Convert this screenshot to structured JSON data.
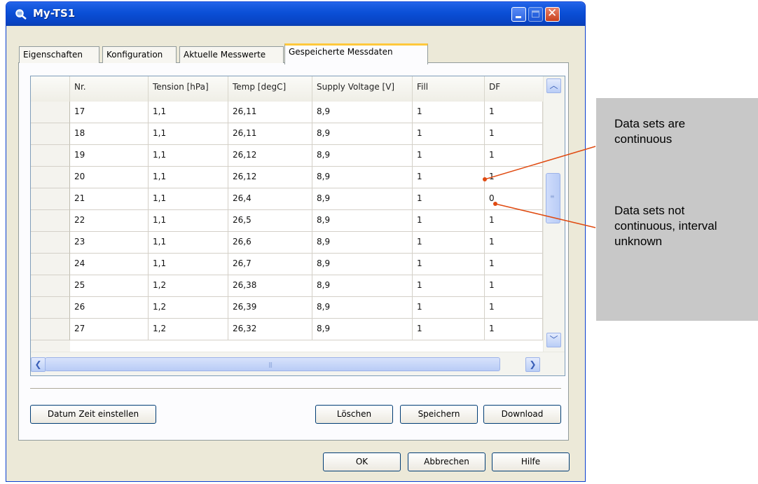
{
  "window": {
    "title": "My-TS1"
  },
  "tabs": [
    {
      "label": "Eigenschaften"
    },
    {
      "label": "Konfiguration"
    },
    {
      "label": "Aktuelle Messwerte"
    },
    {
      "label": "Gespeicherte Messdaten",
      "active": true
    }
  ],
  "grid": {
    "columns": [
      "Nr.",
      "Tension [hPa]",
      "Temp [degC]",
      "Supply Voltage [V]",
      "Fill",
      "DF"
    ],
    "rows": [
      [
        "17",
        "1,1",
        "26,11",
        "8,9",
        "1",
        "1"
      ],
      [
        "18",
        "1,1",
        "26,11",
        "8,9",
        "1",
        "1"
      ],
      [
        "19",
        "1,1",
        "26,12",
        "8,9",
        "1",
        "1"
      ],
      [
        "20",
        "1,1",
        "26,12",
        "8,9",
        "1",
        "1"
      ],
      [
        "21",
        "1,1",
        "26,4",
        "8,9",
        "1",
        "0"
      ],
      [
        "22",
        "1,1",
        "26,5",
        "8,9",
        "1",
        "1"
      ],
      [
        "23",
        "1,1",
        "26,6",
        "8,9",
        "1",
        "1"
      ],
      [
        "24",
        "1,1",
        "26,7",
        "8,9",
        "1",
        "1"
      ],
      [
        "25",
        "1,2",
        "26,38",
        "8,9",
        "1",
        "1"
      ],
      [
        "26",
        "1,2",
        "26,39",
        "8,9",
        "1",
        "1"
      ],
      [
        "27",
        "1,2",
        "26,32",
        "8,9",
        "1",
        "1"
      ]
    ]
  },
  "buttons": {
    "datetime": "Datum Zeit einstellen",
    "delete": "Löschen",
    "save": "Speichern",
    "download": "Download",
    "ok": "OK",
    "cancel": "Abbrechen",
    "help": "Hilfe"
  },
  "annotations": {
    "continuous": "Data sets are continuous",
    "not_continuous": "Data sets not continuous, interval unknown"
  },
  "colors": {
    "callout": "#e04a10",
    "titlebar": "#0a4fd6",
    "note_box": "#c8c8c8"
  }
}
